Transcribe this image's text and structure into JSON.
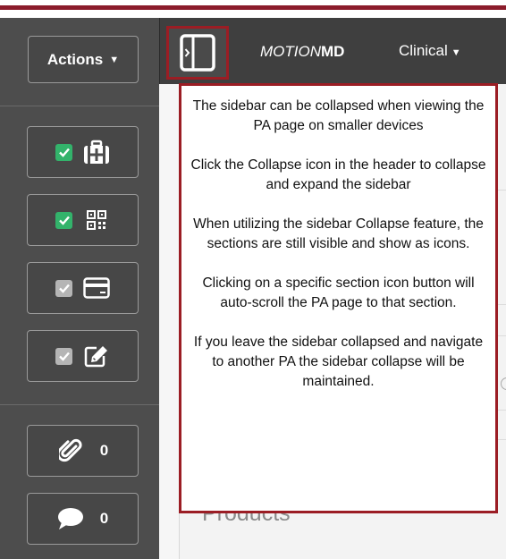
{
  "sidebar": {
    "actions_label": "Actions",
    "sections": [
      {
        "name": "medical-kit",
        "checked": true,
        "check_color": "#33b36b",
        "icon": "medical-kit-icon"
      },
      {
        "name": "qr-code",
        "checked": true,
        "check_color": "#33b36b",
        "icon": "qr-code-icon"
      },
      {
        "name": "card",
        "checked": true,
        "check_color": "#b5b5b5",
        "icon": "credit-card-icon"
      },
      {
        "name": "edit",
        "checked": true,
        "check_color": "#b5b5b5",
        "icon": "edit-icon"
      }
    ],
    "attachments": {
      "icon": "paperclip-icon",
      "count": "0"
    },
    "comments": {
      "icon": "comment-icon",
      "count": "0"
    }
  },
  "header": {
    "brand_part1": "MOTION",
    "brand_part2": "MD",
    "menu_label": "Clinical"
  },
  "tooltip": {
    "paragraphs": [
      "The sidebar can be collapsed when viewing the PA page on smaller devices",
      "Click the Collapse icon in the header to collapse and expand the sidebar",
      "When utilizing the sidebar Collapse feature, the sections are still visible and show as icons.",
      "Clicking on a specific section icon button will auto-scroll the PA page to that section.",
      "If you leave the sidebar collapsed and navigate to another PA the sidebar collapse will be maintained."
    ]
  },
  "main": {
    "section_heading": "Products"
  },
  "colors": {
    "brand_red": "#8b1c2b",
    "highlight_border": "#9b1d24",
    "sidebar_bg": "#4d4d4d",
    "header_bg": "#3f3f3f"
  }
}
